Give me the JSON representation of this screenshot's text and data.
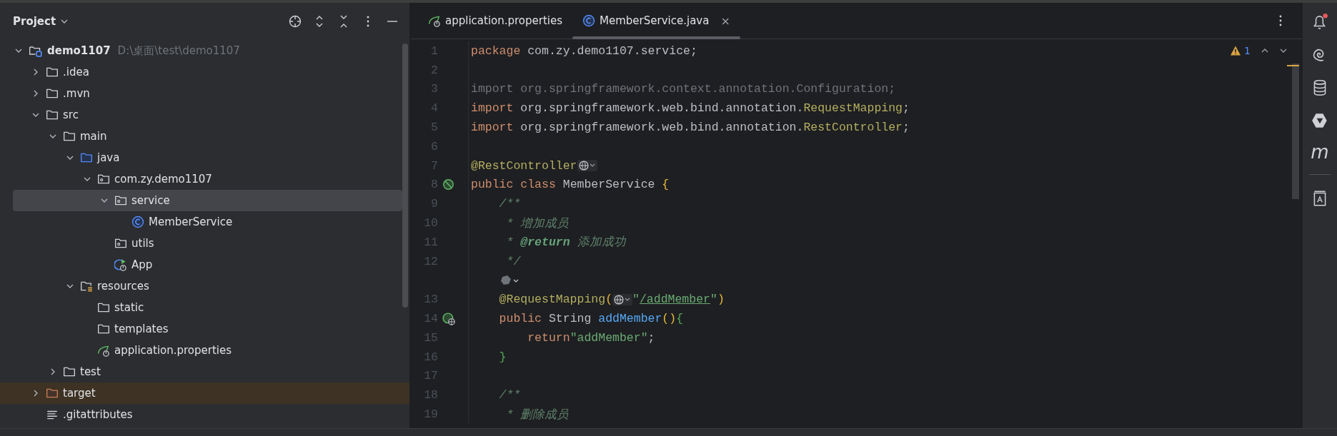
{
  "project_panel": {
    "title": "Project",
    "tree": [
      {
        "name": "demo1107",
        "kind": "module",
        "hint": "D:\\桌面\\test\\demo1107",
        "expanded": true,
        "selected": false,
        "children": [
          {
            "name": ".idea",
            "kind": "folder",
            "expanded": false,
            "selected": false
          },
          {
            "name": ".mvn",
            "kind": "folder",
            "expanded": false,
            "selected": false
          },
          {
            "name": "src",
            "kind": "folder",
            "expanded": true,
            "selected": false,
            "children": [
              {
                "name": "main",
                "kind": "folder",
                "expanded": true,
                "selected": false,
                "children": [
                  {
                    "name": "java",
                    "kind": "source-folder",
                    "expanded": true,
                    "selected": false,
                    "children": [
                      {
                        "name": "com.zy.demo1107",
                        "kind": "package",
                        "expanded": true,
                        "selected": false,
                        "children": [
                          {
                            "name": "service",
                            "kind": "package",
                            "expanded": true,
                            "selected": true,
                            "children": [
                              {
                                "name": "MemberService",
                                "kind": "class",
                                "selected": false
                              }
                            ]
                          },
                          {
                            "name": "utils",
                            "kind": "package",
                            "selected": false
                          },
                          {
                            "name": "App",
                            "kind": "spring-app",
                            "selected": false
                          }
                        ]
                      }
                    ]
                  },
                  {
                    "name": "resources",
                    "kind": "resources",
                    "expanded": true,
                    "selected": false,
                    "children": [
                      {
                        "name": "static",
                        "kind": "folder",
                        "selected": false
                      },
                      {
                        "name": "templates",
                        "kind": "folder",
                        "selected": false
                      },
                      {
                        "name": "application.properties",
                        "kind": "spring-props",
                        "selected": false
                      }
                    ]
                  }
                ]
              },
              {
                "name": "test",
                "kind": "folder",
                "expanded": false,
                "selected": false
              }
            ]
          },
          {
            "name": "target",
            "kind": "excluded-folder",
            "expanded": false,
            "selected": false
          },
          {
            "name": ".gitattributes",
            "kind": "text-file",
            "selected": false
          }
        ]
      }
    ]
  },
  "editor": {
    "tabs": [
      {
        "label": "application.properties",
        "kind": "spring-props",
        "selected": false
      },
      {
        "label": "MemberService.java",
        "kind": "class",
        "selected": true,
        "close": "×"
      }
    ],
    "warning_count": "1",
    "lines": [
      {
        "kind": "code",
        "number": "1",
        "tokens": [
          {
            "kind": "keyword",
            "text": "package "
          },
          {
            "kind": "plain",
            "text": "com.zy.demo1107.service;"
          }
        ]
      },
      {
        "kind": "code",
        "number": "2"
      },
      {
        "kind": "code",
        "number": "3",
        "tokens": [
          {
            "kind": "unused",
            "text": "import org.springframework.context.annotation.Configuration;"
          }
        ]
      },
      {
        "kind": "code",
        "number": "4",
        "tokens": [
          {
            "kind": "keyword",
            "text": "import "
          },
          {
            "kind": "plain",
            "text": "org.springframework.web.bind.annotation."
          },
          {
            "kind": "annotation",
            "text": "RequestMapping"
          },
          {
            "kind": "plain",
            "text": ";"
          }
        ]
      },
      {
        "kind": "code",
        "number": "5",
        "tokens": [
          {
            "kind": "keyword",
            "text": "import "
          },
          {
            "kind": "plain",
            "text": "org.springframework.web.bind.annotation."
          },
          {
            "kind": "annotation",
            "text": "RestController"
          },
          {
            "kind": "plain",
            "text": ";"
          }
        ]
      },
      {
        "kind": "code",
        "number": "6"
      },
      {
        "kind": "code",
        "number": "7",
        "tokens": [
          {
            "kind": "annotation",
            "text": "@RestController"
          },
          {
            "kind": "globe-hint"
          }
        ]
      },
      {
        "kind": "code",
        "number": "8",
        "gutter": {
          "kind": "bean"
        },
        "tokens": [
          {
            "kind": "keyword",
            "text": "public class "
          },
          {
            "kind": "plain",
            "text": "MemberService "
          },
          {
            "kind": "bracket-1",
            "text": "{"
          }
        ]
      },
      {
        "kind": "code",
        "number": "9",
        "tokens": [
          {
            "kind": "comment",
            "text": "    /**"
          }
        ]
      },
      {
        "kind": "code",
        "number": "10",
        "tokens": [
          {
            "kind": "comment",
            "text": "     * 增加成员"
          }
        ]
      },
      {
        "kind": "code",
        "number": "11",
        "tokens": [
          {
            "kind": "comment",
            "text": "     * "
          },
          {
            "kind": "doc-tag",
            "text": "@return"
          },
          {
            "kind": "comment",
            "text": " 添加成功"
          }
        ]
      },
      {
        "kind": "code",
        "number": "12",
        "tokens": [
          {
            "kind": "comment",
            "text": "     */"
          }
        ]
      },
      {
        "kind": "inlay",
        "tokens": [
          {
            "kind": "spring-hint"
          }
        ]
      },
      {
        "kind": "code",
        "number": "13",
        "tokens": [
          {
            "kind": "annotation",
            "text": "    @RequestMapping"
          },
          {
            "kind": "bracket-1",
            "text": "("
          },
          {
            "kind": "globe-hint"
          },
          {
            "kind": "string",
            "text": "\""
          },
          {
            "kind": "url",
            "text": "/addMember"
          },
          {
            "kind": "string",
            "text": "\""
          },
          {
            "kind": "bracket-1",
            "text": ")"
          }
        ]
      },
      {
        "kind": "code",
        "number": "14",
        "gutter": {
          "kind": "web"
        },
        "tokens": [
          {
            "kind": "keyword",
            "text": "    public "
          },
          {
            "kind": "plain",
            "text": "String "
          },
          {
            "kind": "method",
            "text": "addMember"
          },
          {
            "kind": "bracket-1",
            "text": "()"
          },
          {
            "kind": "bracket-2",
            "text": "{"
          }
        ]
      },
      {
        "kind": "code",
        "number": "15",
        "tokens": [
          {
            "kind": "keyword",
            "text": "        return"
          },
          {
            "kind": "string",
            "text": "\"addMember\""
          },
          {
            "kind": "plain",
            "text": ";"
          }
        ]
      },
      {
        "kind": "code",
        "number": "16",
        "tokens": [
          {
            "kind": "bracket-2",
            "text": "    }"
          }
        ]
      },
      {
        "kind": "code",
        "number": "17"
      },
      {
        "kind": "code",
        "number": "18",
        "tokens": [
          {
            "kind": "comment",
            "text": "    /**"
          }
        ]
      },
      {
        "kind": "code",
        "number": "19",
        "tokens": [
          {
            "kind": "comment",
            "text": "     * 删除成员"
          }
        ]
      }
    ]
  },
  "tool_strip": [
    {
      "kind": "notifications",
      "badge": true
    },
    {
      "kind": "spiral"
    },
    {
      "kind": "database"
    },
    {
      "kind": "ai-assistant"
    },
    {
      "kind": "maven",
      "label": "m"
    },
    {
      "kind": "divider"
    },
    {
      "kind": "book"
    }
  ]
}
